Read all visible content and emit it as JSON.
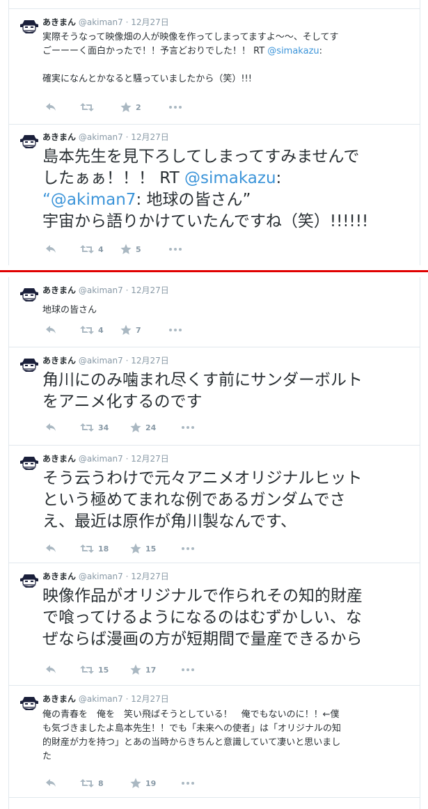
{
  "colors": {
    "divider": "#e00000",
    "link": "#3b94d9",
    "meta": "#8899a6"
  },
  "tweets": [
    {
      "name": "あきまん",
      "handle": "@akiman7",
      "time": "12月27日",
      "lines": [
        "実際そうなって映像畑の人が映像を作ってしまってますよ〜〜、そしてす",
        "ごーーーく面白かったで！！予言どおりでした！！ RT ",
        "",
        "確実になんとかなると騒っていましたから（笑）!!!"
      ],
      "mention": "@simakazu",
      "mention_suffix": ":",
      "retweets": "",
      "favorites": "2"
    },
    {
      "name": "あきまん",
      "handle": "@akiman7",
      "time": "12月27日",
      "line1": "島本先生を見下ろしてしまってすみませんで",
      "line2a": "したぁぁ！！！ RT ",
      "mention1": "@simakazu",
      "line2b": ":",
      "line3a": "“",
      "mention2": "@akiman7",
      "line3b": ": 地球の皆さん”",
      "line4": "宇宙から語りかけていたんですね（笑）!!!!!!",
      "retweets": "4",
      "favorites": "5"
    },
    {
      "name": "あきまん",
      "handle": "@akiman7",
      "time": "12月27日",
      "text": "地球の皆さん",
      "retweets": "4",
      "favorites": "7"
    },
    {
      "name": "あきまん",
      "handle": "@akiman7",
      "time": "12月27日",
      "lines": [
        "角川にのみ噛まれ尽くす前にサンダーボルト",
        "をアニメ化するのです"
      ],
      "retweets": "34",
      "favorites": "24"
    },
    {
      "name": "あきまん",
      "handle": "@akiman7",
      "time": "12月27日",
      "lines": [
        "そう云うわけで元々アニメオリジナルヒット",
        "という極めてまれな例であるガンダムでさ",
        "え、最近は原作が角川製なんです、"
      ],
      "retweets": "18",
      "favorites": "15"
    },
    {
      "name": "あきまん",
      "handle": "@akiman7",
      "time": "12月27日",
      "lines": [
        "映像作品がオリジナルで作られその知的財産",
        "で喰ってけるようになるのはむずかしい、な",
        "ぜならば漫画の方が短期間で量産できるから"
      ],
      "retweets": "15",
      "favorites": "17"
    },
    {
      "name": "あきまん",
      "handle": "@akiman7",
      "time": "12月27日",
      "lines": [
        "俺の青春を　俺を　笑い飛ばそうとしている！　俺でもないのに！！←僕",
        "も気づきましたよ島本先生！！でも「未来への使者」は「オリジナルの知",
        "的財産が力を持つ」とあの当時からきちんと意識していて凄いと思いまし",
        "た"
      ],
      "retweets": "8",
      "favorites": "19"
    }
  ]
}
